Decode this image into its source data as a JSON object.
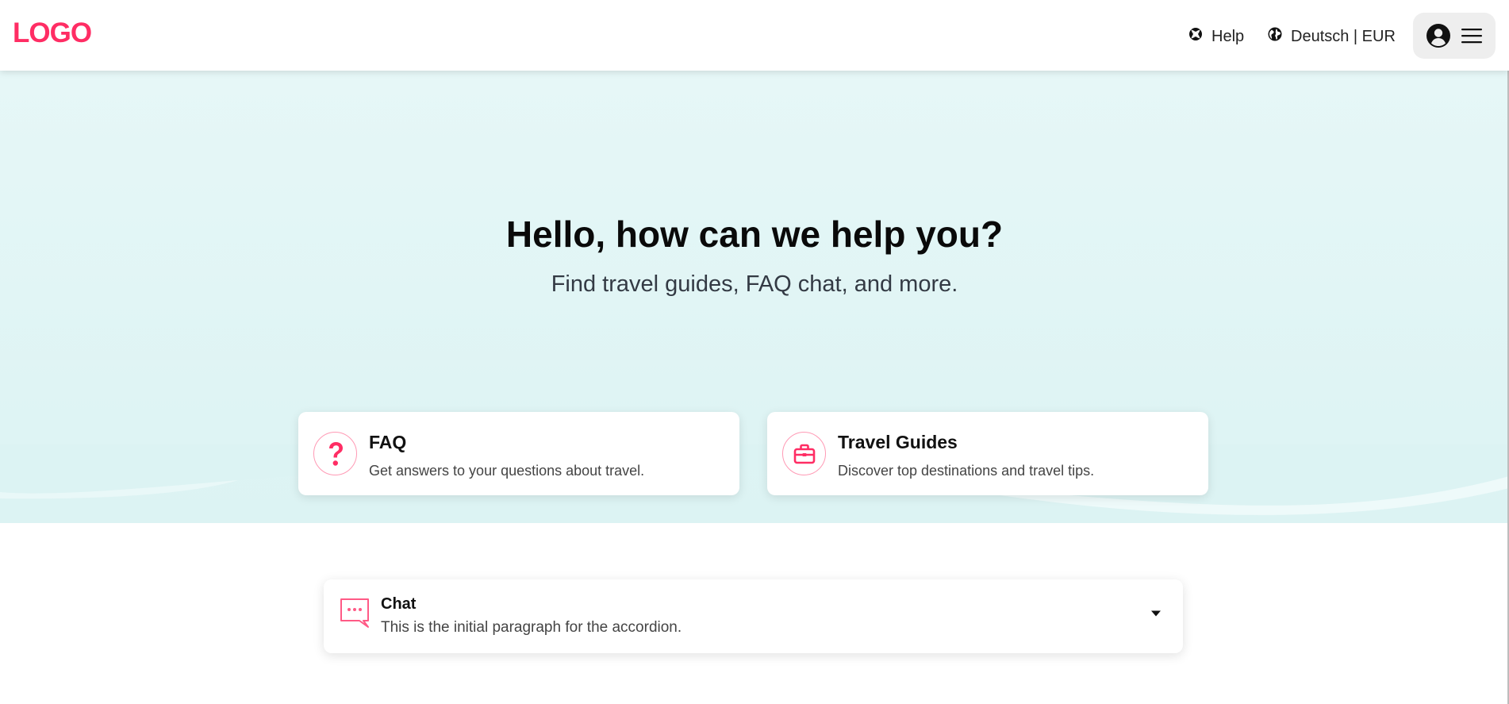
{
  "header": {
    "logo": "LOGO",
    "help_label": "Help",
    "locale_label": "Deutsch | EUR"
  },
  "hero": {
    "title": "Hello, how can we help you?",
    "subtitle": "Find travel guides, FAQ chat, and more."
  },
  "cards": [
    {
      "title": "FAQ",
      "description": "Get answers to your questions about travel.",
      "icon": "question-icon"
    },
    {
      "title": "Travel Guides",
      "description": "Discover top destinations and travel tips.",
      "icon": "briefcase-icon"
    }
  ],
  "accordion": {
    "title": "Chat",
    "description": "This is the initial paragraph for the accordion.",
    "icon": "chat-bubble-icon",
    "expanded": false
  },
  "colors": {
    "brand": "#ff2d64",
    "hero_bg": "#e6f7f7"
  }
}
